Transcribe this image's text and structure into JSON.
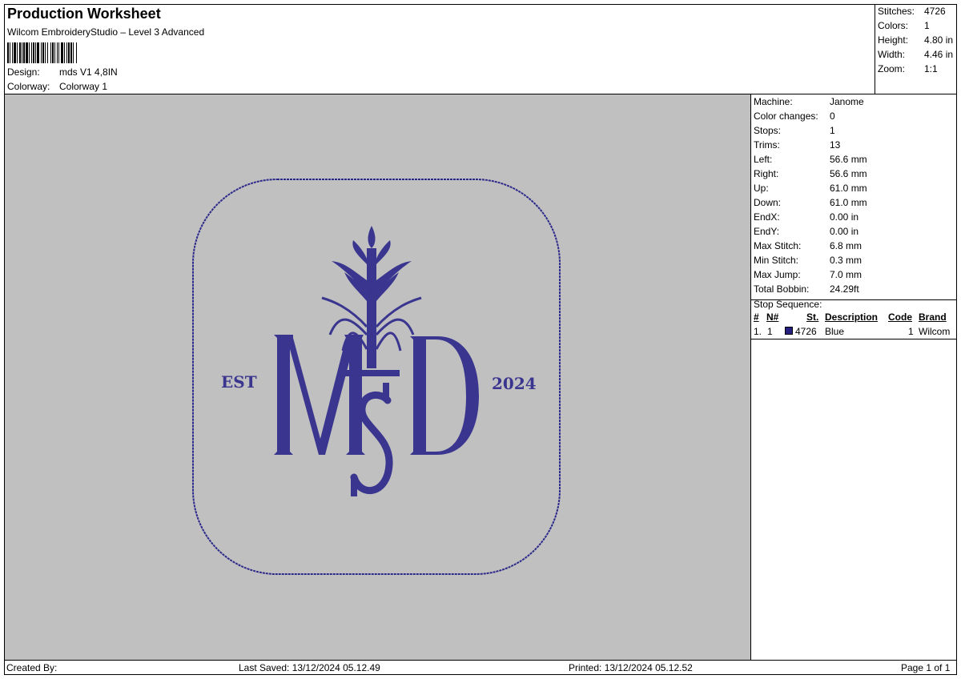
{
  "header": {
    "title": "Production Worksheet",
    "subtitle": "Wilcom EmbroideryStudio – Level 3 Advanced",
    "design_label": "Design:",
    "design_value": "mds V1 4,8IN",
    "colorway_label": "Colorway:",
    "colorway_value": "Colorway 1"
  },
  "summary": {
    "stitches_label": "Stitches:",
    "stitches_value": "4726",
    "colors_label": "Colors:",
    "colors_value": "1",
    "height_label": "Height:",
    "height_value": "4.80 in",
    "width_label": "Width:",
    "width_value": "4.46 in",
    "zoom_label": "Zoom:",
    "zoom_value": "1:1"
  },
  "design_art": {
    "left_text": "EST",
    "right_text": "2024",
    "thread_color": "#2d2a8a",
    "background_color": "#c0c0c0"
  },
  "machine_info": [
    {
      "label": "Machine:",
      "value": "Janome"
    },
    {
      "label": "Color changes:",
      "value": "0"
    },
    {
      "label": "Stops:",
      "value": "1"
    },
    {
      "label": "Trims:",
      "value": "13"
    },
    {
      "label": "Left:",
      "value": "56.6 mm"
    },
    {
      "label": "Right:",
      "value": "56.6 mm"
    },
    {
      "label": "Up:",
      "value": "61.0 mm"
    },
    {
      "label": "Down:",
      "value": "61.0 mm"
    },
    {
      "label": "EndX:",
      "value": "0.00 in"
    },
    {
      "label": "EndY:",
      "value": "0.00 in"
    },
    {
      "label": "Max Stitch:",
      "value": "6.8 mm"
    },
    {
      "label": "Min Stitch:",
      "value": "0.3 mm"
    },
    {
      "label": "Max Jump:",
      "value": "7.0 mm"
    },
    {
      "label": "Total Bobbin:",
      "value": "24.29ft"
    }
  ],
  "stop_sequence": {
    "title": "Stop Sequence:",
    "headers": {
      "num": "#",
      "n": "N#",
      "st": "St.",
      "description": "Description",
      "code": "Code",
      "brand": "Brand"
    },
    "rows": [
      {
        "num": "1.",
        "n": "1",
        "st": "4726",
        "description": "Blue",
        "code": "1",
        "brand": "Wilcom",
        "color": "#252080"
      }
    ]
  },
  "footer": {
    "created_by": "Created By:",
    "last_saved": "Last Saved: 13/12/2024 05.12.49",
    "printed": "Printed: 13/12/2024 05.12.52",
    "page": "Page 1 of 1"
  }
}
